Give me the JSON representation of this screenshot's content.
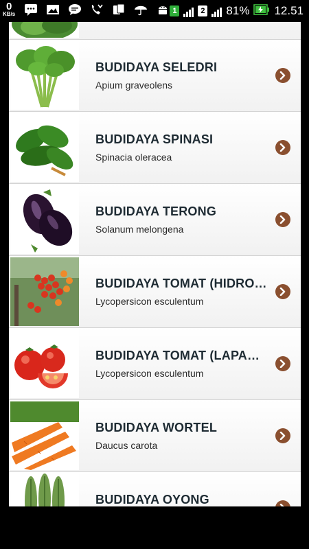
{
  "status_bar": {
    "speed_value": "0",
    "speed_unit": "KB/s",
    "battery_percent": "81%",
    "time": "12.51",
    "sim1": "1",
    "sim2": "2",
    "icons": [
      "bbm-icon",
      "gallery-icon",
      "chat-icon",
      "missed-call-icon",
      "sim-manager-icon",
      "umbrella-icon",
      "android-icon"
    ]
  },
  "list": {
    "items": [
      {
        "title": "",
        "subtitle": "",
        "icon": "lettuce-thumb"
      },
      {
        "title": "BUDIDAYA SELEDRI",
        "subtitle": "Apium graveolens",
        "icon": "celery-thumb"
      },
      {
        "title": "BUDIDAYA SPINASI",
        "subtitle": "Spinacia oleracea",
        "icon": "spinach-thumb"
      },
      {
        "title": "BUDIDAYA TERONG",
        "subtitle": "Solanum melongena",
        "icon": "eggplant-thumb"
      },
      {
        "title": "BUDIDAYA TOMAT (HIDRO…",
        "subtitle": "Lycopersicon esculentum",
        "icon": "tomato-vine-thumb"
      },
      {
        "title": "BUDIDAYA TOMAT (LAPA…",
        "subtitle": "Lycopersicon esculentum",
        "icon": "tomato-thumb"
      },
      {
        "title": "BUDIDAYA WORTEL",
        "subtitle": "Daucus carota",
        "icon": "carrot-thumb"
      },
      {
        "title": "BUDIDAYA OYONG",
        "subtitle": "",
        "icon": "luffa-thumb"
      }
    ]
  },
  "colors": {
    "chevron": "#8a4f2f",
    "title": "#1e2b33",
    "battery": "#3fbf3f",
    "sim_badge": "#2fae3a"
  }
}
